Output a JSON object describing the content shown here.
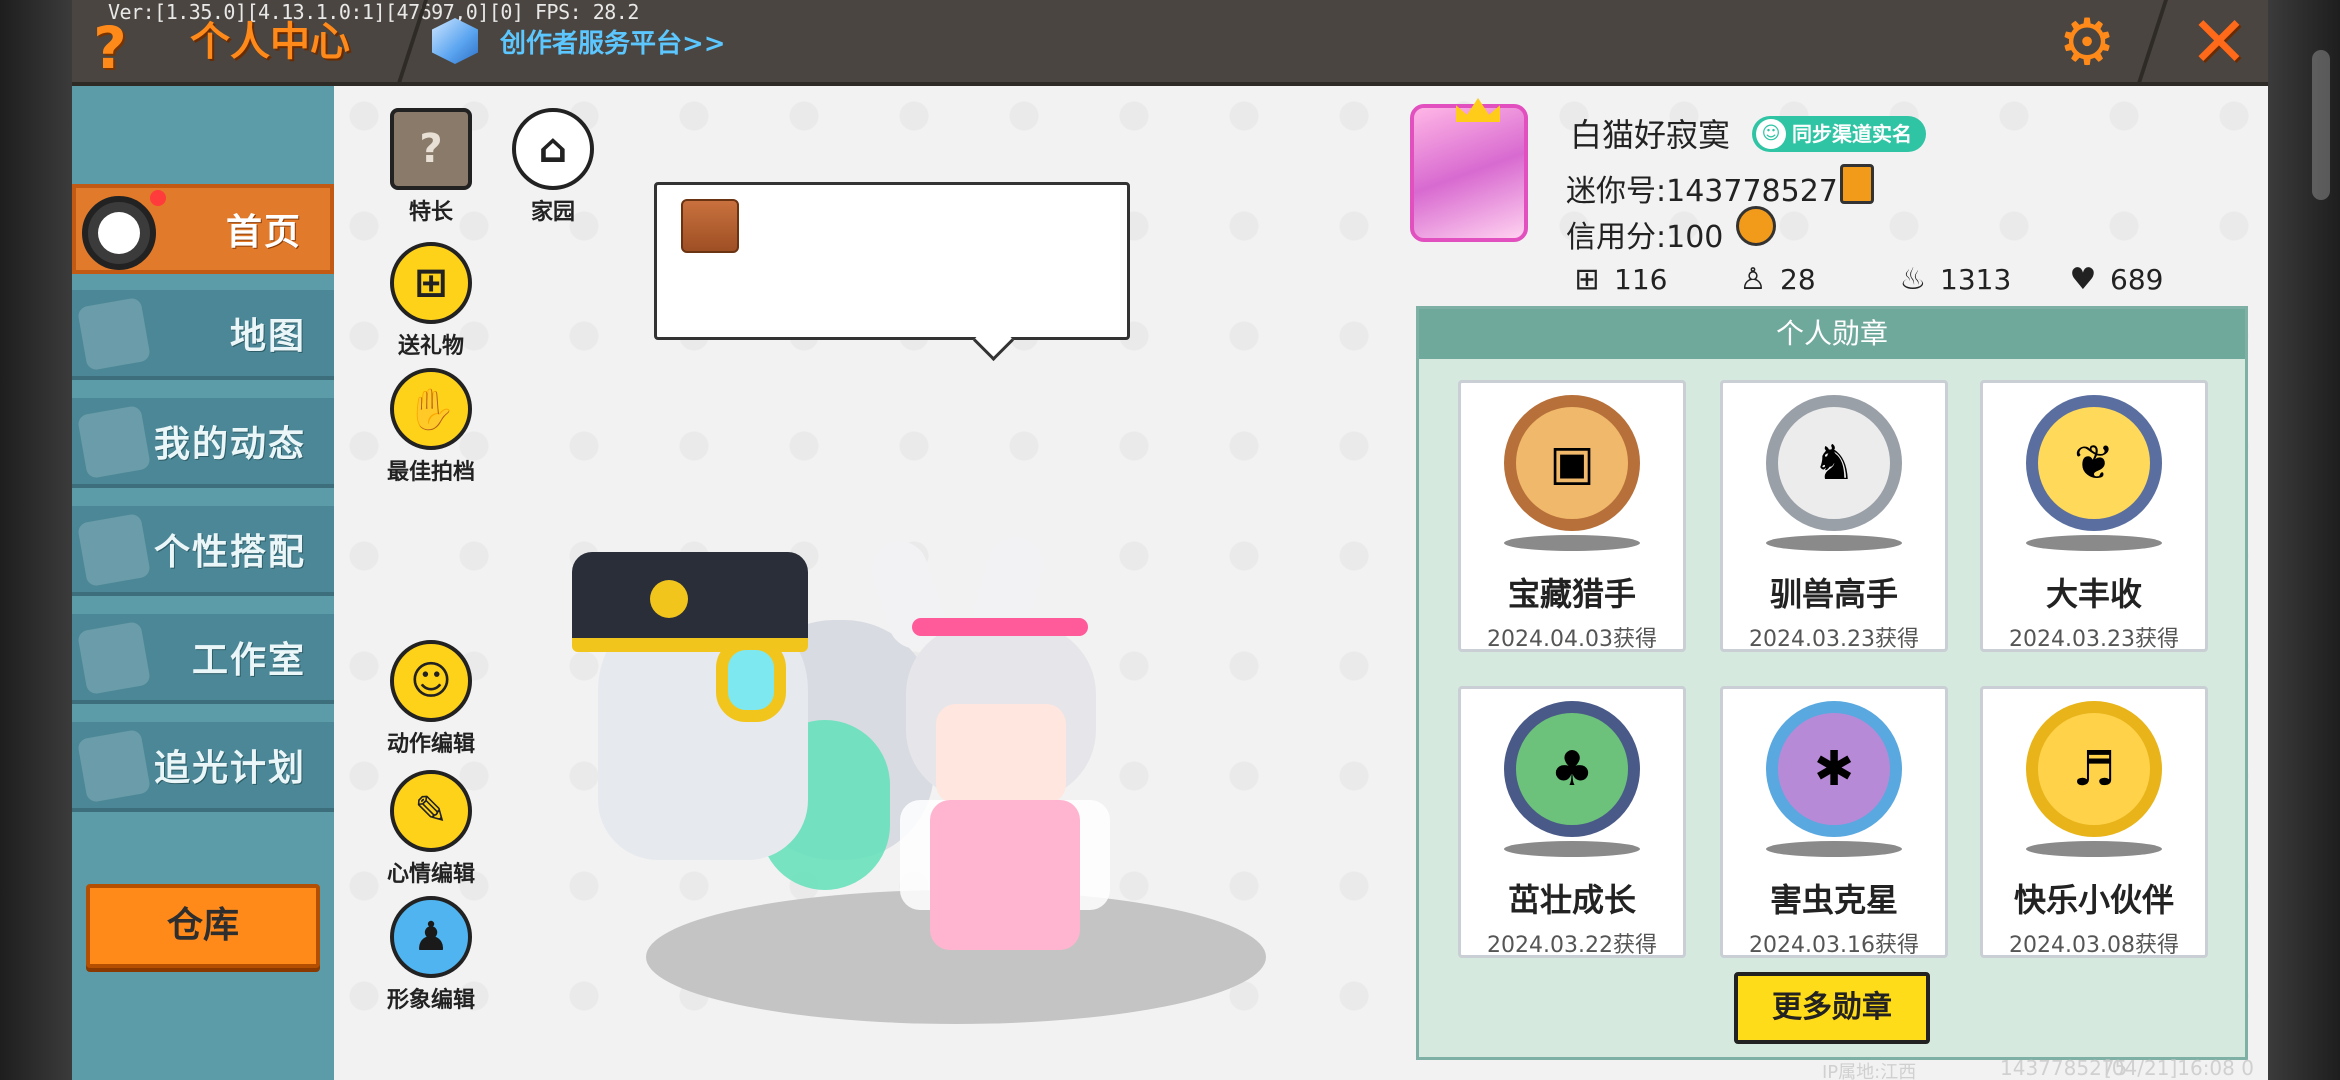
{
  "debug": "Ver:[1.35.0][4.13.1.0:1][47697,0][0]  FPS: 28.2",
  "topbar": {
    "help_label": "?",
    "title": "个人中心",
    "creator_link": "创作者服务平台>>",
    "settings_icon": "gear-icon",
    "close_icon": "close-icon"
  },
  "sidebar": {
    "items": [
      {
        "label": "首页",
        "active": true
      },
      {
        "label": "地图"
      },
      {
        "label": "我的动态"
      },
      {
        "label": "个性搭配"
      },
      {
        "label": "工作室"
      },
      {
        "label": "追光计划"
      }
    ],
    "warehouse": "仓库"
  },
  "features": {
    "talent": "特长",
    "home": "家园",
    "gift": "送礼物",
    "best_shot": "最佳拍档",
    "action_edit": "动作编辑",
    "mood_edit": "心情编辑",
    "look_edit": "形象编辑"
  },
  "profile": {
    "name": "白猫好寂寞",
    "sync_badge": "同步渠道实名",
    "mini_id": "迷你号:1437785275",
    "credit": "信用分:100",
    "stats": {
      "plus": "116",
      "fans": "28",
      "fire": "1313",
      "hearts": "689"
    }
  },
  "medals": {
    "header": "个人勋章",
    "items": [
      {
        "name": "宝藏猎手",
        "date": "2024.04.03获得",
        "ring": "#b7703a"
      },
      {
        "name": "驯兽高手",
        "date": "2024.03.23获得",
        "ring": "#9aa0a8"
      },
      {
        "name": "大丰收",
        "date": "2024.03.23获得",
        "ring": "#5a6fa0"
      },
      {
        "name": "茁壮成长",
        "date": "2024.03.22获得",
        "ring": "#4a5a88"
      },
      {
        "name": "害虫克星",
        "date": "2024.03.16获得",
        "ring": "#5aa8e0"
      },
      {
        "name": "快乐小伙伴",
        "date": "2024.03.08获得",
        "ring": "#e8b41a"
      }
    ],
    "more_label": "更多勋章"
  },
  "footer": {
    "ip": "IP属地:江西",
    "uid": "1437785275",
    "time": "[04/21]16:08 0"
  }
}
